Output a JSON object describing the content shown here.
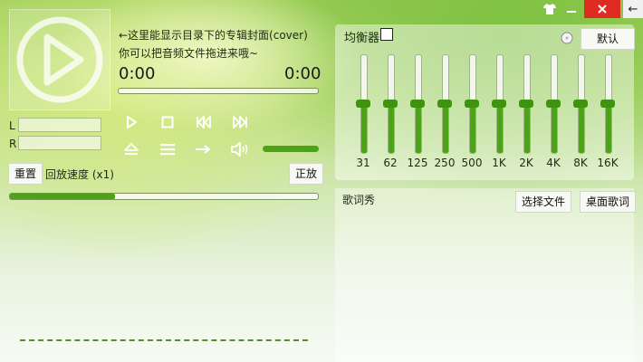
{
  "window": {
    "controls": {
      "skin_icon": "shirt-icon",
      "minimize_icon": "minimize-icon",
      "close_icon": "close-icon",
      "back_label": "←"
    }
  },
  "player": {
    "cover_hint_line1": "←这里能显示目录下的专辑封面(cover)",
    "cover_hint_line2": "你可以把音频文件拖进来哦~",
    "time_current": "0:00",
    "time_total": "0:00",
    "progress": 0.0,
    "left_label": "L",
    "right_label": "R",
    "left_level": 0.0,
    "right_level": 0.0,
    "volume": 1.0,
    "transport_icons": [
      "play-icon",
      "stop-icon",
      "previous-icon",
      "next-icon",
      "eject-icon",
      "playlist-icon",
      "repeat-icon",
      "volume-icon"
    ]
  },
  "playback": {
    "reset_label": "重置",
    "speed_label": "回放速度 (x1)",
    "forward_label": "正放",
    "speed": 0.34
  },
  "equalizer": {
    "title": "均衡器",
    "enabled": false,
    "preset_label": "默认",
    "bands": [
      {
        "label": "31",
        "level": 0.5
      },
      {
        "label": "62",
        "level": 0.5
      },
      {
        "label": "125",
        "level": 0.5
      },
      {
        "label": "250",
        "level": 0.5
      },
      {
        "label": "500",
        "level": 0.5
      },
      {
        "label": "1K",
        "level": 0.5
      },
      {
        "label": "2K",
        "level": 0.5
      },
      {
        "label": "4K",
        "level": 0.5
      },
      {
        "label": "8K",
        "level": 0.5
      },
      {
        "label": "16K",
        "level": 0.5
      }
    ]
  },
  "lyrics": {
    "title": "歌词秀",
    "choose_file_label": "选择文件",
    "desktop_lyrics_label": "桌面歌词"
  },
  "colors": {
    "accent": "#4ca315",
    "close": "#e02b23"
  }
}
